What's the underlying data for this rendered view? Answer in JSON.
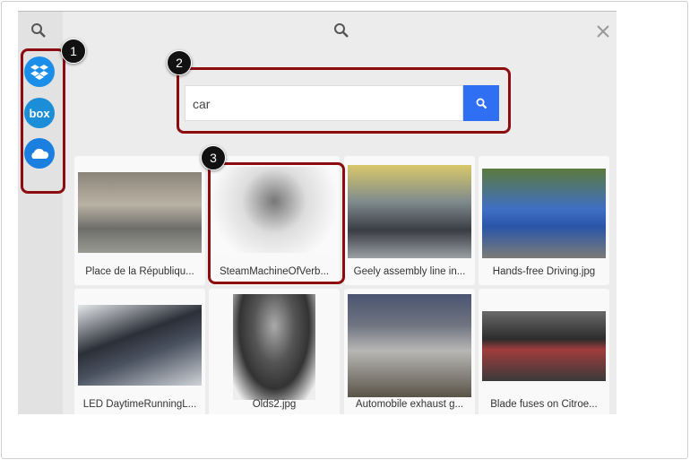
{
  "query": "car",
  "callouts": [
    "1",
    "2",
    "3"
  ],
  "services": [
    {
      "name": "Dropbox",
      "label": "",
      "color": "#1a8ee8"
    },
    {
      "name": "Box",
      "label": "box",
      "color": "#1c8ed8"
    },
    {
      "name": "OneDrive",
      "label": "",
      "color": "#1b7fe0"
    }
  ],
  "results": [
    {
      "caption": "Place de la Républiqu..."
    },
    {
      "caption": "SteamMachineOfVerb..."
    },
    {
      "caption": "Geely assembly line in..."
    },
    {
      "caption": "Hands-free Driving.jpg"
    },
    {
      "caption": "LED DaytimeRunningL..."
    },
    {
      "caption": "Olds2.jpg"
    },
    {
      "caption": "Automobile exhaust g..."
    },
    {
      "caption": "Blade fuses on Citroe..."
    }
  ],
  "colors": {
    "accent": "#2f6ff3",
    "highlight": "#8c0c10"
  }
}
